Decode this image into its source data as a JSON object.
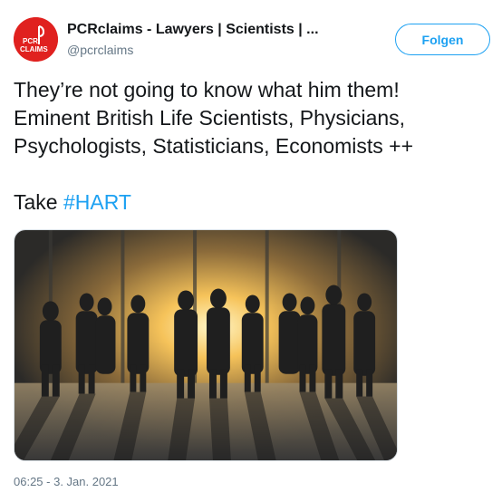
{
  "author": {
    "display_name": "PCRclaims - Lawyers | Scientists | ...",
    "handle": "@pcrclaims",
    "avatar_text_top": "PCR",
    "avatar_text_bottom": "CLAIMS",
    "avatar_color": "#e0211f"
  },
  "follow_button": {
    "label": "Folgen"
  },
  "tweet": {
    "lines": [
      "They’re not going to know what him them!",
      "Eminent British Life Scientists, Physicians,",
      "Psychologists, Statisticians, Economists ++"
    ],
    "take_prefix": "Take ",
    "hashtag": "#HART"
  },
  "media": {
    "description_icon": "group-silhouettes-image"
  },
  "timestamp": "06:25 - 3. Jan. 2021",
  "colors": {
    "accent": "#1da1f2",
    "secondary_text": "#657786"
  }
}
